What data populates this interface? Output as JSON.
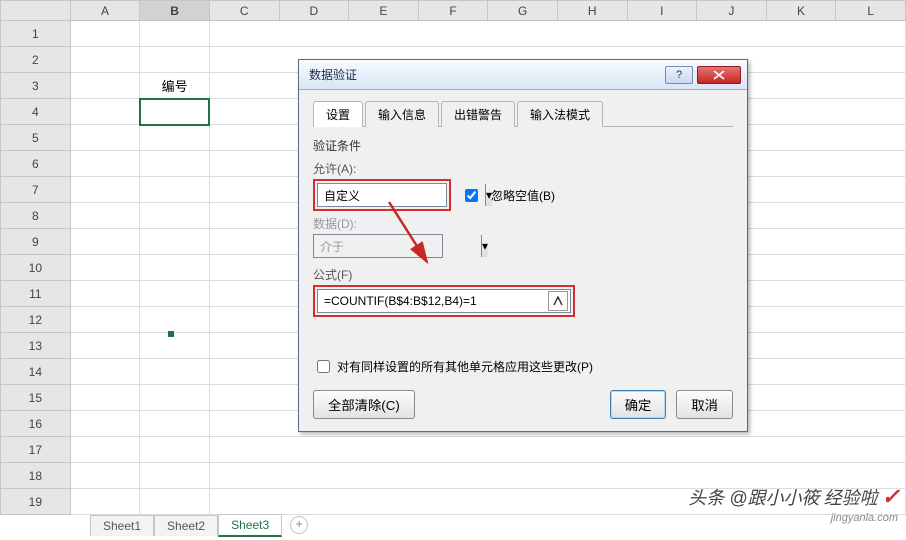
{
  "columns": [
    "A",
    "B",
    "C",
    "D",
    "E",
    "F",
    "G",
    "H",
    "I",
    "J",
    "K",
    "L"
  ],
  "rows": [
    "1",
    "2",
    "3",
    "4",
    "5",
    "6",
    "7",
    "8",
    "9",
    "10",
    "11",
    "12",
    "13",
    "14",
    "15",
    "16",
    "17",
    "18",
    "19"
  ],
  "selected_col": "B",
  "header_cell": "编号",
  "sheet_tabs": {
    "items": [
      "Sheet1",
      "Sheet2",
      "Sheet3"
    ],
    "active": "Sheet3"
  },
  "dialog": {
    "title": "数据验证",
    "tabs": [
      "设置",
      "输入信息",
      "出错警告",
      "输入法模式"
    ],
    "active_tab": "设置",
    "section_label": "验证条件",
    "allow_label": "允许(A):",
    "allow_value": "自定义",
    "ignore_blank_label": "忽略空值(B)",
    "ignore_blank_checked": true,
    "data_label": "数据(D):",
    "data_value": "介于",
    "formula_label": "公式(F)",
    "formula_value": "=COUNTIF(B$4:B$12,B4)=1",
    "apply_others_label": "对有同样设置的所有其他单元格应用这些更改(P)",
    "apply_others_checked": false,
    "clear_all": "全部清除(C)",
    "ok": "确定",
    "cancel": "取消"
  },
  "watermark": {
    "prefix": "头条 @跟小小筱",
    "suffix": "经验啦",
    "sub": "jingyanla.com"
  }
}
